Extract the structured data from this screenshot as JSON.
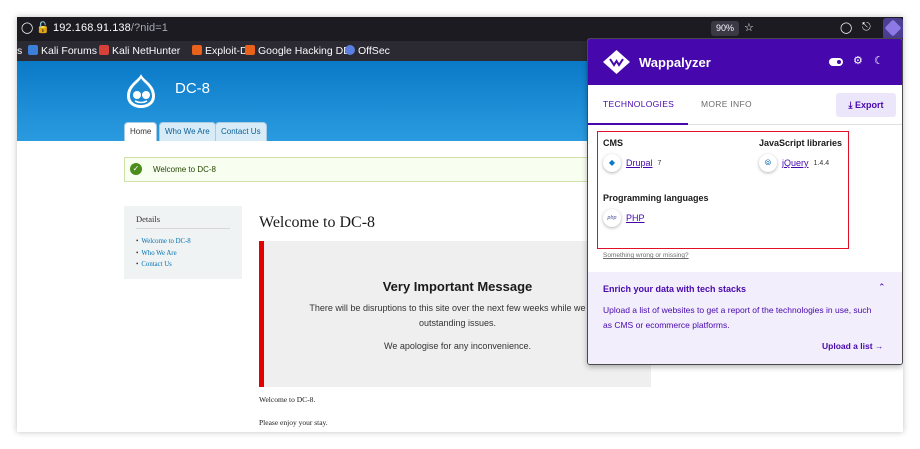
{
  "browser": {
    "url_host": "192.168.91.138",
    "url_path": "/?nid=1",
    "zoom": "90%",
    "bookmarks": [
      "s",
      "Kali Forums",
      "Kali NetHunter",
      "Exploit-DB",
      "Google Hacking DB",
      "OffSec"
    ]
  },
  "site": {
    "name": "DC-8",
    "tabs": [
      "Home",
      "Who We Are",
      "Contact Us"
    ],
    "status_message": "Welcome to DC-8",
    "sidebar": {
      "title": "Details",
      "links": [
        "Welcome to DC-8",
        "Who We Are",
        "Contact Us"
      ]
    },
    "content": {
      "title": "Welcome to DC-8",
      "box_title": "Very Important Message",
      "box_line1": "There will be disruptions to this site over the next few weeks while we reso",
      "box_line2": "outstanding issues.",
      "box_line3": "We apologise for any inconvenience.",
      "para1": "Welcome to DC-8.",
      "para2": "Please enjoy your stay."
    }
  },
  "wappalyzer": {
    "brand": "Wappalyzer",
    "tab_technologies": "TECHNOLOGIES",
    "tab_more_info": "MORE INFO",
    "export_label": "Export",
    "categories": {
      "cms": {
        "label": "CMS",
        "name": "Drupal",
        "version": "7"
      },
      "js": {
        "label": "JavaScript libraries",
        "name": "jQuery",
        "version": "1.4.4"
      },
      "lang": {
        "label": "Programming languages",
        "name": "PHP"
      }
    },
    "wrong_link": "Something wrong or missing?",
    "enrich": {
      "title": "Enrich your data with tech stacks",
      "body": "Upload a list of websites to get a report of the technologies in use, such as CMS or ecommerce platforms.",
      "link": "Upload a list"
    }
  },
  "colors": {
    "wappalyzer_purple": "#4608ad",
    "drupal_blue": "#0a7ac8",
    "highlight_red": "#e0102a",
    "message_bar_red": "#e30000"
  }
}
